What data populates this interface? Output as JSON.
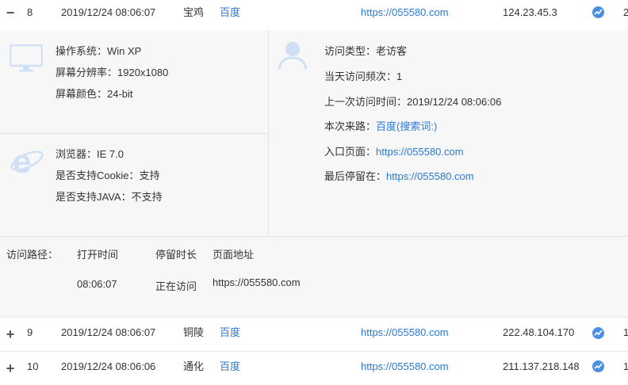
{
  "rows": [
    {
      "toggle": "−",
      "index": "8",
      "time": "2019/12/24 08:06:07",
      "city": "宝鸡",
      "source": "百度",
      "url": "https://055580.com",
      "ip": "124.23.45.3",
      "extra": "2"
    },
    {
      "toggle": "+",
      "index": "9",
      "time": "2019/12/24 08:06:07",
      "city": "铜陵",
      "source": "百度",
      "url": "https://055580.com",
      "ip": "222.48.104.170",
      "extra": "1"
    },
    {
      "toggle": "+",
      "index": "10",
      "time": "2019/12/24 08:06:06",
      "city": "通化",
      "source": "百度",
      "url": "https://055580.com",
      "ip": "211.137.218.148",
      "extra": "1"
    }
  ],
  "detail": {
    "os_label": "操作系统：",
    "os_value": "Win XP",
    "res_label": "屏幕分辨率：",
    "res_value": "1920x1080",
    "color_label": "屏幕颜色：",
    "color_value": "24-bit",
    "browser_label": "浏览器：",
    "browser_value": "IE 7.0",
    "cookie_label": "是否支持Cookie：",
    "cookie_value": "支持",
    "java_label": "是否支持JAVA：",
    "java_value": "不支持",
    "visit_type_label": "访问类型：",
    "visit_type_value": "老访客",
    "freq_label": "当天访问频次：",
    "freq_value": "1",
    "last_label": "上一次访问时间：",
    "last_value": "2019/12/24 08:06:06",
    "from_label": "本次来路：",
    "from_value": "百度(搜索词:)",
    "entry_label": "入口页面：",
    "entry_value": "https://055580.com",
    "exit_label": "最后停留在：",
    "exit_value": "https://055580.com",
    "path_label": "访问路径：",
    "path_headers": {
      "open": "打开时间",
      "stay": "停留时长",
      "page": "页面地址"
    },
    "path_rows": [
      {
        "open": "08:06:07",
        "stay": "正在访问",
        "page": "https://055580.com"
      }
    ]
  },
  "colors": {
    "link": "#2a7ad2",
    "icon": "#cfe0f5",
    "trend": "#4a90e2"
  }
}
